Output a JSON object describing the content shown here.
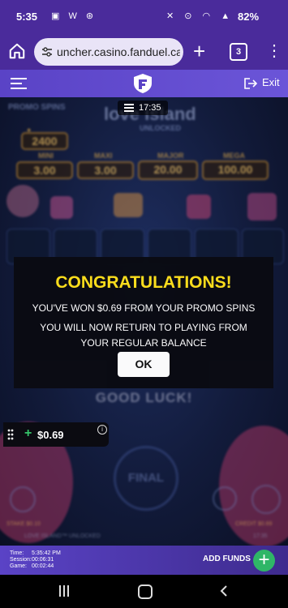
{
  "status_bar": {
    "time": "5:35",
    "left_icons": [
      "image-icon",
      "w-icon",
      "game-icon"
    ],
    "left_glyphs": "▣ W ⊛",
    "right_icons": [
      "mute-icon",
      "location-icon",
      "wifi-icon",
      "signal-icon"
    ],
    "right_glyphs": "✕ ⊙ ◠ ▲",
    "battery": "82%"
  },
  "browser": {
    "url": "uncher.casino.fanduel.ca",
    "tab_count": "3"
  },
  "app_header": {
    "exit_label": "Exit"
  },
  "game": {
    "clock": "17:35",
    "promo_spins_label": "PROMO SPINS",
    "title_logo": "love island",
    "unlocked_label": "UNLOCKED",
    "jackpots": [
      {
        "label": "MINI",
        "value": "3.00"
      },
      {
        "label": "MAXI",
        "value": "3.00"
      },
      {
        "label": "MAJOR",
        "value": "20.00"
      },
      {
        "label": "MEGA",
        "value": "100.00"
      }
    ],
    "counter": "2400",
    "good_luck": "GOOD LUCK!",
    "final_label": "FINAL",
    "stake_label": "STAKE $0.10",
    "credit_label": "CREDIT $0.69",
    "footer_game_label": "LOVE ISLAND™ UNLOCKED",
    "footer_time": "17:35"
  },
  "modal": {
    "title": "CONGRATULATIONS!",
    "line1": "YOU'VE WON $0.69 FROM YOUR PROMO SPINS",
    "line2": "YOU WILL NOW RETURN TO PLAYING FROM YOUR REGULAR BALANCE",
    "ok_label": "OK"
  },
  "balance": {
    "amount": "$0.69"
  },
  "footer": {
    "time_label": "Time:",
    "time_value": "5:35:42 PM",
    "session_label": "Session:",
    "session_value": "00:06:31",
    "game_label": "Game:",
    "game_value": "00:02:44",
    "add_funds_label": "ADD FUNDS"
  },
  "colors": {
    "browser_purple": "#4a2b9b",
    "brand_purple": "#5a43c6",
    "congrats_yellow": "#ffe11c",
    "add_green": "#2fb667"
  }
}
